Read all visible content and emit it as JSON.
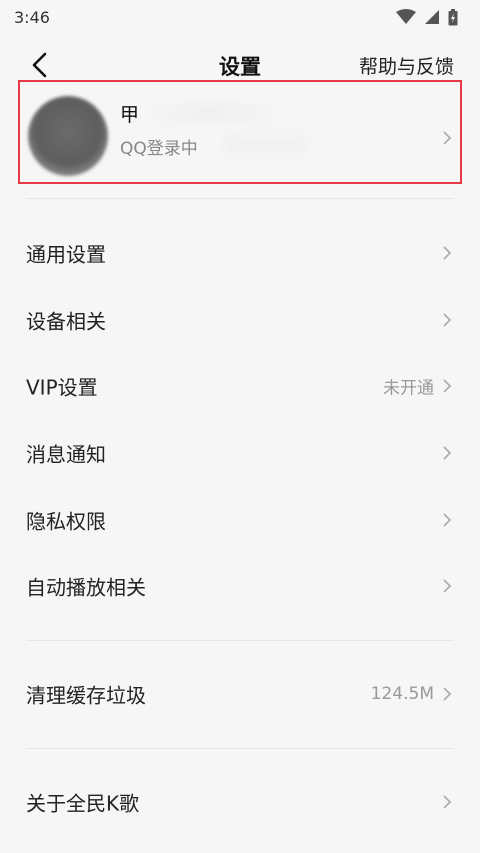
{
  "status_bar": {
    "time": "3:46",
    "icons": [
      "wifi-icon",
      "signal-icon",
      "battery-icon"
    ]
  },
  "nav": {
    "back_icon": "chevron-left-icon",
    "title": "设置",
    "help_label": "帮助与反馈"
  },
  "account": {
    "name": "甲",
    "login_status": "QQ登录中",
    "highlight_color": "#e63946"
  },
  "menu": [
    {
      "label": "通用设置",
      "value": ""
    },
    {
      "label": "设备相关",
      "value": ""
    },
    {
      "label": "VIP设置",
      "value": "未开通"
    },
    {
      "label": "消息通知",
      "value": ""
    },
    {
      "label": "隐私权限",
      "value": ""
    },
    {
      "label": "自动播放相关",
      "value": ""
    },
    {
      "label": "清理缓存垃圾",
      "value": "124.5M"
    },
    {
      "label": "关于全民K歌",
      "value": ""
    }
  ]
}
